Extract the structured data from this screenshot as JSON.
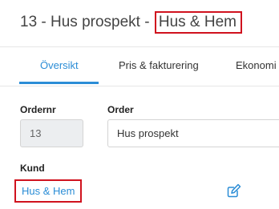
{
  "header": {
    "title_prefix": "13 - Hus prospekt - ",
    "title_highlight": "Hus & Hem"
  },
  "tabs": [
    {
      "label": "Översikt",
      "active": true
    },
    {
      "label": "Pris & fakturering",
      "active": false
    },
    {
      "label": "Ekonomi",
      "active": false
    }
  ],
  "form": {
    "ordernr_label": "Ordernr",
    "ordernr_value": "13",
    "order_label": "Order",
    "order_value": "Hus prospekt",
    "kund_label": "Kund",
    "kund_value": "Hus & Hem"
  },
  "colors": {
    "accent": "#2b8dd6",
    "highlight_border": "#d0121e"
  },
  "icons": {
    "edit": "edit-pencil-icon"
  }
}
